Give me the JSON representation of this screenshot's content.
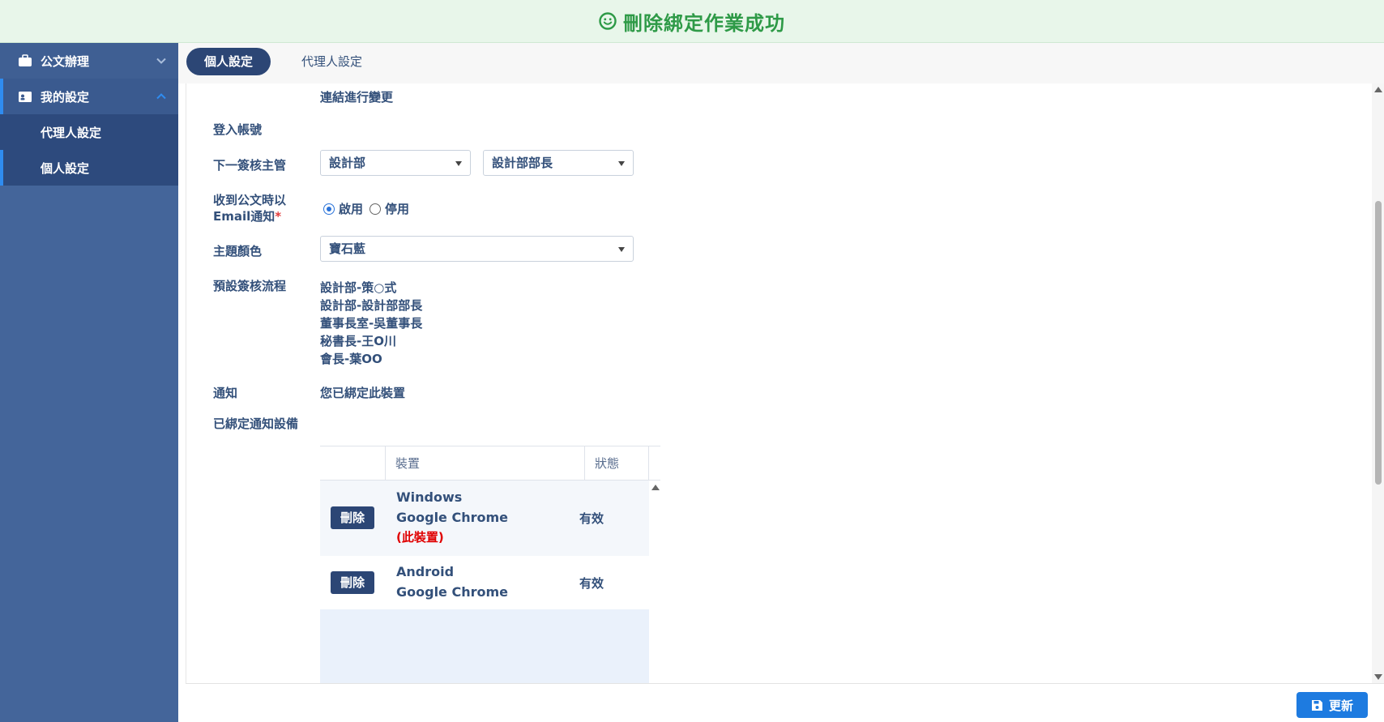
{
  "banner": {
    "message": "刪除綁定作業成功",
    "icon": "smile-icon",
    "color": "#2e9a47"
  },
  "sidebar": {
    "items": [
      {
        "label": "公文辦理",
        "icon": "briefcase-icon",
        "expanded": false
      },
      {
        "label": "我的設定",
        "icon": "id-card-icon",
        "expanded": true,
        "children": [
          {
            "label": "代理人設定",
            "active": false
          },
          {
            "label": "個人設定",
            "active": true
          }
        ]
      }
    ]
  },
  "tabs": [
    {
      "label": "個人設定",
      "active": true
    },
    {
      "label": "代理人設定",
      "active": false
    }
  ],
  "form": {
    "link_change_text": "連結進行變更",
    "login_account_label": "登入帳號",
    "login_account_value": "",
    "next_reviewer_label": "下一簽核主管",
    "next_reviewer_dept": "設計部",
    "next_reviewer_person": "設計部部長",
    "email_notify_label_1": "收到公文時以",
    "email_notify_label_2": "Email通知",
    "email_notify_required": "*",
    "email_notify_options": [
      {
        "label": "啟用",
        "selected": true
      },
      {
        "label": "停用",
        "selected": false
      }
    ],
    "theme_label": "主題顏色",
    "theme_value": "寶石藍",
    "flow_label": "預設簽核流程",
    "flow_steps": [
      "設計部-策○式",
      "設計部-設計部部長",
      "董事長室-吳董事長",
      "秘書長-王O川",
      "會長-葉OO"
    ],
    "notify_label": "通知",
    "notify_value": "您已綁定此裝置",
    "bound_devices_label": "已綁定通知設備"
  },
  "devices_table": {
    "headers": [
      "",
      "裝置",
      "狀態"
    ],
    "rows": [
      {
        "delete_label": "刪除",
        "os": "Windows",
        "browser": "Google Chrome",
        "note": "(此裝置)",
        "status": "有效"
      },
      {
        "delete_label": "刪除",
        "os": "Android",
        "browser": "Google Chrome",
        "note": "",
        "status": "有效"
      }
    ]
  },
  "footer": {
    "save_label": "更新",
    "save_icon": "floppy-disk-icon"
  },
  "colors": {
    "sidebar_bg": "#44659a",
    "active_tab": "#2c4675",
    "primary_button": "#1e7be0",
    "accent_border": "#2f8cf0",
    "required": "#e23b3b",
    "this_device": "#e00000"
  }
}
